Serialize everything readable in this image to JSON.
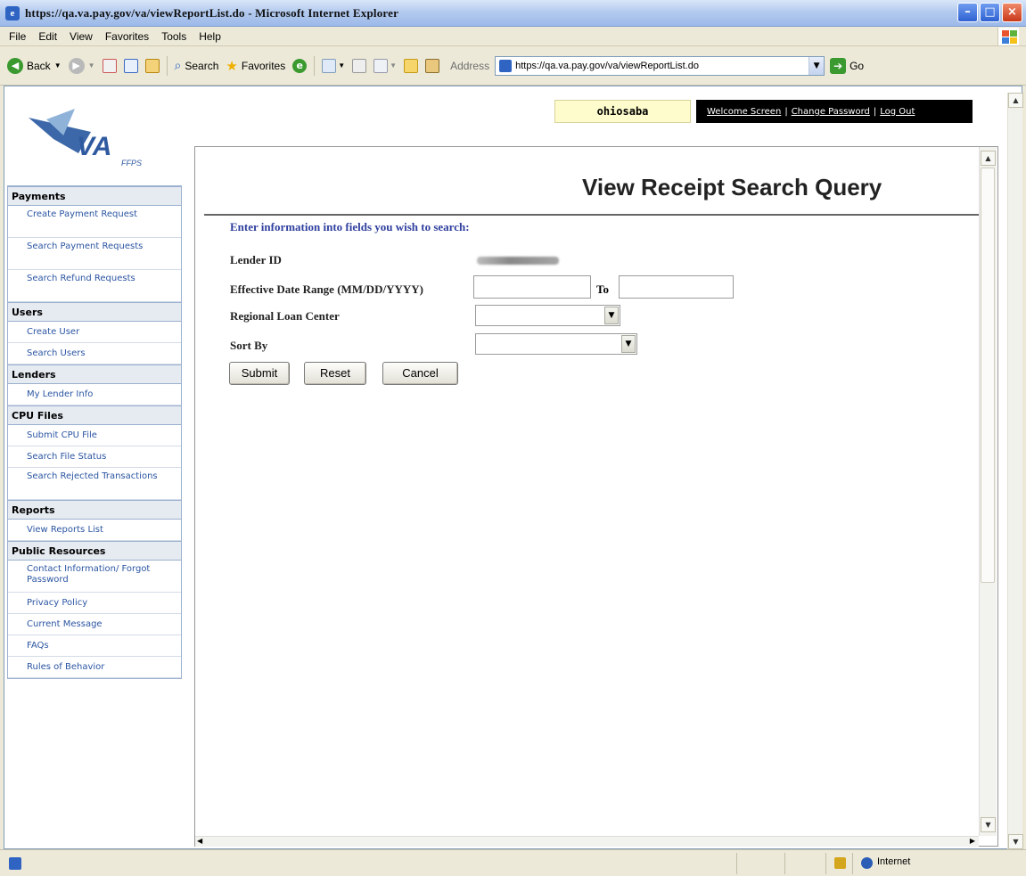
{
  "window": {
    "title": "https://qa.va.pay.gov/va/viewReportList.do - Microsoft Internet Explorer",
    "icon": "ie-icon",
    "controls": [
      "minimize",
      "maximize",
      "close"
    ]
  },
  "menu": [
    "File",
    "Edit",
    "View",
    "Favorites",
    "Tools",
    "Help"
  ],
  "toolbar": {
    "back": "Back",
    "search": "Search",
    "favorites": "Favorites",
    "address_label": "Address",
    "address": "https://qa.va.pay.gov/va/viewReportList.do",
    "go": "Go"
  },
  "header": {
    "username": "ohiosaba",
    "links": [
      "Welcome Screen",
      "Change Password",
      "Log Out"
    ],
    "separator": "|"
  },
  "logo": {
    "text": "VA",
    "sub": "FFPS"
  },
  "sidebar": [
    {
      "heading": "Payments",
      "items": [
        "Create Payment Request",
        "Search Payment Requests",
        "Search Refund Requests"
      ]
    },
    {
      "heading": "Users",
      "items": [
        "Create User",
        "Search Users"
      ]
    },
    {
      "heading": "Lenders",
      "items": [
        "My Lender Info"
      ]
    },
    {
      "heading": "CPU Files",
      "items": [
        "Submit CPU File",
        "Search File Status",
        "Search Rejected Transactions"
      ]
    },
    {
      "heading": "Reports",
      "items": [
        "View Reports List"
      ]
    },
    {
      "heading": "Public Resources",
      "items": [
        "Contact Information/ Forgot Password",
        "Privacy Policy",
        "Current Message",
        "FAQs",
        "Rules of Behavior"
      ]
    }
  ],
  "page": {
    "title": "View Receipt Search Query",
    "instruction": "Enter information into fields you wish to search:",
    "fields": {
      "lender_id": "Lender ID",
      "date_range": "Effective Date Range (MM/DD/YYYY)",
      "to": "To",
      "regional": "Regional Loan Center",
      "sort_by": "Sort By"
    },
    "values": {
      "date_from": "",
      "date_to": "",
      "regional": "",
      "sort_by": ""
    },
    "buttons": {
      "submit": "Submit",
      "reset": "Reset",
      "cancel": "Cancel"
    }
  },
  "status": {
    "zone": "Internet"
  }
}
